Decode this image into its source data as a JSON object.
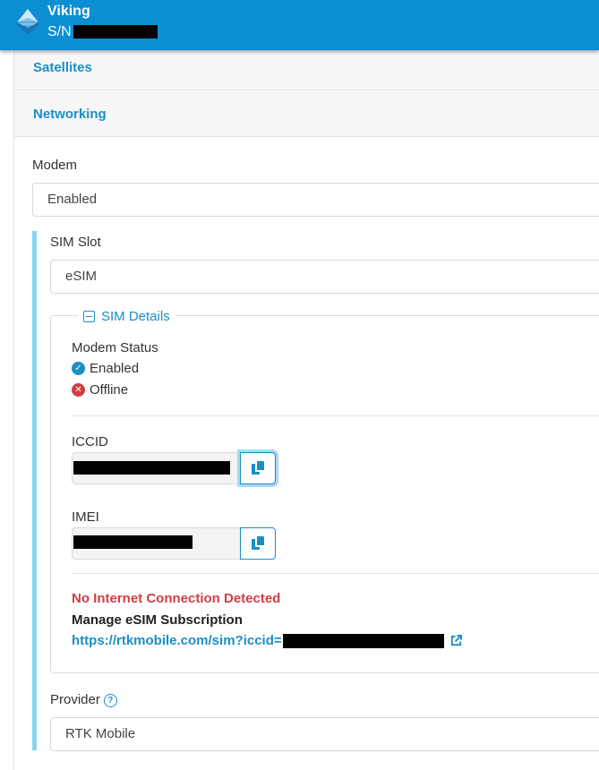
{
  "header": {
    "device_name": "Viking",
    "sn_label": "S/N",
    "brand_color": "#0c8ed3"
  },
  "sections": {
    "satellites": "Satellites",
    "networking": "Networking"
  },
  "modem": {
    "label": "Modem",
    "value": "Enabled"
  },
  "sim_slot": {
    "label": "SIM Slot",
    "value": "eSIM"
  },
  "sim_details": {
    "legend": "SIM Details",
    "modem_status_label": "Modem Status",
    "status_enabled": "Enabled",
    "status_offline": "Offline",
    "iccid_label": "ICCID",
    "imei_label": "IMEI"
  },
  "internet": {
    "alert": "No Internet Connection Detected",
    "manage_label": "Manage eSIM Subscription",
    "link_prefix": "https://rtkmobile.com/sim?iccid="
  },
  "provider": {
    "label": "Provider",
    "value": "RTK Mobile"
  },
  "icons": {
    "logo": "layered-pyramid-logo",
    "collapse": "minus-square-icon",
    "enabled": "check-circle-icon",
    "offline": "x-circle-icon",
    "copy": "copy-icon",
    "external": "external-link-icon",
    "help": "question-circle-icon"
  }
}
